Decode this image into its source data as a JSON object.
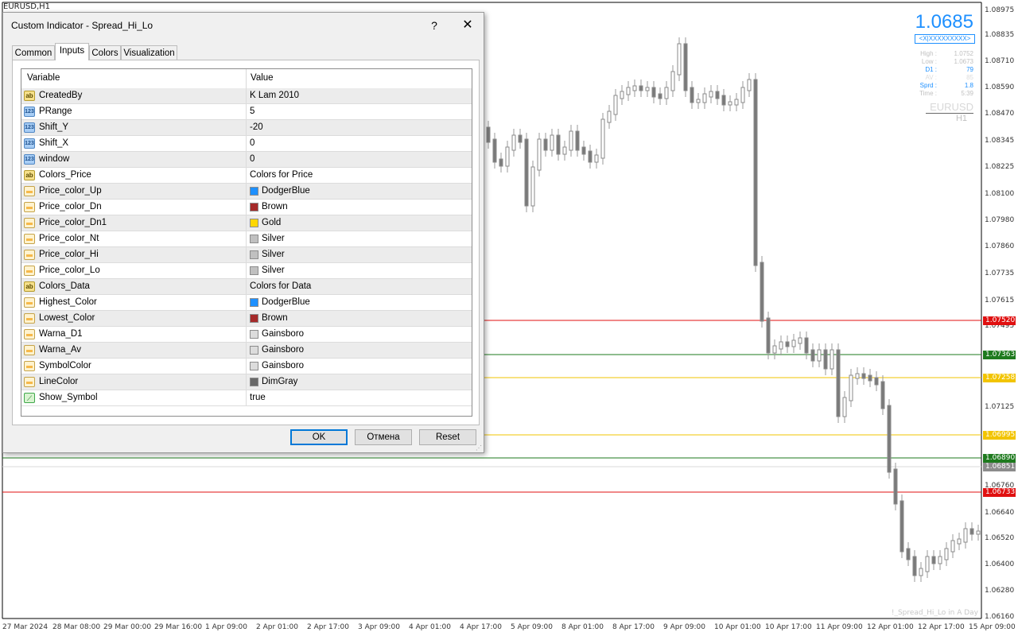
{
  "chart": {
    "title": "EURUSD,H1",
    "price_labels": [
      "1.08975",
      "1.08835",
      "1.08710",
      "1.08590",
      "1.08470",
      "1.08345",
      "1.08225",
      "1.08100",
      "1.07980",
      "1.07860",
      "1.07735",
      "1.07615",
      "1.07495",
      "1.07125",
      "1.06760",
      "1.06640",
      "1.06520",
      "1.06400",
      "1.06280",
      "1.06160"
    ],
    "level_tags": [
      {
        "value": "1.07520",
        "color": "#e01010"
      },
      {
        "value": "1.07363",
        "color": "#1e7a1e"
      },
      {
        "value": "1.07258",
        "color": "#f2c400"
      },
      {
        "value": "1.06995",
        "color": "#f2c400"
      },
      {
        "value": "1.06890",
        "color": "#1e7a1e"
      },
      {
        "value": "1.06851",
        "color": "#8c8c8c"
      },
      {
        "value": "1.06733",
        "color": "#e01010"
      }
    ],
    "time_labels": [
      "27 Mar 2024",
      "28 Mar 08:00",
      "29 Mar 00:00",
      "29 Mar 16:00",
      "1 Apr 09:00",
      "2 Apr 01:00",
      "2 Apr 17:00",
      "3 Apr 09:00",
      "4 Apr 01:00",
      "4 Apr 17:00",
      "5 Apr 09:00",
      "8 Apr 01:00",
      "8 Apr 17:00",
      "9 Apr 09:00",
      "10 Apr 01:00",
      "10 Apr 17:00",
      "11 Apr 09:00",
      "12 Apr 01:00",
      "12 Apr 17:00",
      "15 Apr 09:00"
    ],
    "credit": "!_Spread_Hi_Lo in A Day"
  },
  "info": {
    "bid": "1.0685",
    "code": "<X|XXXXXXXXX>",
    "rows": [
      {
        "k": "High :",
        "v": "1.0752",
        "color": "#c0c0c0"
      },
      {
        "k": "Low :",
        "v": "1.0673",
        "color": "#c0c0c0"
      },
      {
        "k": "D1 :",
        "v": "79",
        "color": "#1e90ff"
      },
      {
        "k": "AV :",
        "v": "85",
        "color": "#dcdcdc"
      },
      {
        "k": "Sprd :",
        "v": "1.8",
        "color": "#1e90ff"
      },
      {
        "k": "Time :",
        "v": "5:39",
        "color": "#c0c0c0"
      }
    ],
    "symbol": "EURUSD",
    "timeframe": "H1"
  },
  "dialog": {
    "title": "Custom Indicator - Spread_Hi_Lo",
    "help": "?",
    "close": "✕",
    "tabs": [
      "Common",
      "Inputs",
      "Colors",
      "Visualization"
    ],
    "active_tab": "Inputs",
    "columns": {
      "variable": "Variable",
      "value": "Value"
    },
    "rows": [
      {
        "icon": "ab",
        "name": "CreatedBy",
        "value": "K Lam 2010"
      },
      {
        "icon": "123",
        "name": "PRange",
        "value": "5"
      },
      {
        "icon": "123",
        "name": "Shift_Y",
        "value": "-20"
      },
      {
        "icon": "123",
        "name": "Shift_X",
        "value": "0"
      },
      {
        "icon": "123",
        "name": "window",
        "value": "0"
      },
      {
        "icon": "ab",
        "name": "Colors_Price",
        "value": "Colors for Price"
      },
      {
        "icon": "color",
        "name": "Price_color_Up",
        "value": "DodgerBlue",
        "swatch": "#1e90ff"
      },
      {
        "icon": "color",
        "name": "Price_color_Dn",
        "value": "Brown",
        "swatch": "#a52a2a"
      },
      {
        "icon": "color",
        "name": "Price_color_Dn1",
        "value": "Gold",
        "swatch": "#ffd700"
      },
      {
        "icon": "color",
        "name": "Price_color_Nt",
        "value": "Silver",
        "swatch": "#c0c0c0"
      },
      {
        "icon": "color",
        "name": "Price_color_Hi",
        "value": "Silver",
        "swatch": "#c0c0c0"
      },
      {
        "icon": "color",
        "name": "Price_color_Lo",
        "value": "Silver",
        "swatch": "#c0c0c0"
      },
      {
        "icon": "ab",
        "name": "Colors_Data",
        "value": "Colors for Data"
      },
      {
        "icon": "color",
        "name": "Highest_Color",
        "value": "DodgerBlue",
        "swatch": "#1e90ff"
      },
      {
        "icon": "color",
        "name": "Lowest_Color",
        "value": "Brown",
        "swatch": "#a52a2a"
      },
      {
        "icon": "color",
        "name": "Warna_D1",
        "value": "Gainsboro",
        "swatch": "#dcdcdc"
      },
      {
        "icon": "color",
        "name": "Warna_Av",
        "value": "Gainsboro",
        "swatch": "#dcdcdc"
      },
      {
        "icon": "color",
        "name": "SymbolColor",
        "value": "Gainsboro",
        "swatch": "#dcdcdc"
      },
      {
        "icon": "color",
        "name": "LineColor",
        "value": "DimGray",
        "swatch": "#696969"
      },
      {
        "icon": "bool",
        "name": "Show_Symbol",
        "value": "true"
      }
    ],
    "buttons": {
      "ok": "OK",
      "cancel": "Отмена",
      "reset": "Reset"
    }
  }
}
